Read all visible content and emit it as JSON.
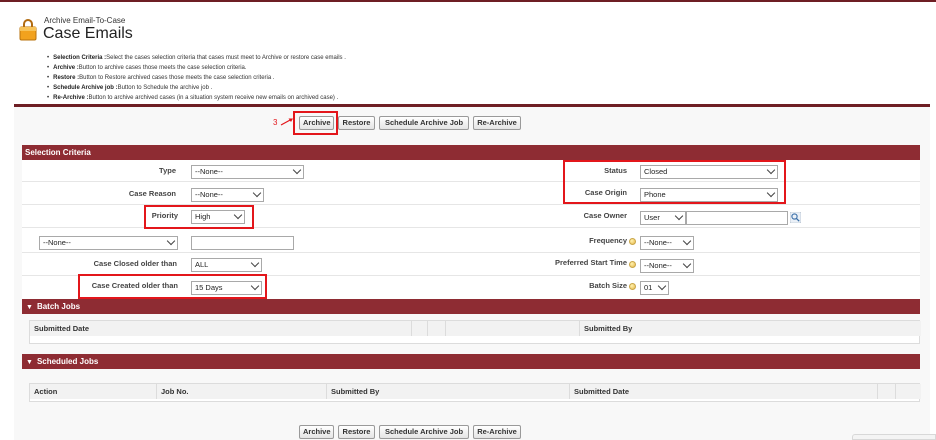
{
  "header": {
    "breadcrumb": "Archive Email-To-Case",
    "title": "Case Emails"
  },
  "description": [
    {
      "term": "Selection Criteria :",
      "text": "Select the cases selection criteria that cases must meet to Archive or restore case emails ."
    },
    {
      "term": "Archive :",
      "text": "Button to archive cases those meets the case selection criteria."
    },
    {
      "term": "Restore :",
      "text": "Button to Restore archived cases those meets the case selection criteria ."
    },
    {
      "term": "Schedule Archive job :",
      "text": "Button to Schedule the archive job ."
    },
    {
      "term": "Re-Archive :",
      "text": "Button to archive archived cases (in a situation system receive new emails on archived case) ."
    }
  ],
  "buttons": {
    "archive": "Archive",
    "restore": "Restore",
    "schedule": "Schedule Archive Job",
    "rearchive": "Re-Archive"
  },
  "annotation_marker": "3",
  "colors": {
    "accent": "#8e2c33",
    "highlight": "#e3161b",
    "topline": "#6e1e24"
  },
  "selection_criteria": {
    "heading": "Selection Criteria",
    "type": {
      "label": "Type",
      "value": "--None--"
    },
    "case_reason": {
      "label": "Case Reason",
      "value": "--None--"
    },
    "priority": {
      "label": "Priority",
      "value": "High"
    },
    "custom_field": {
      "value": "--None--",
      "text_value": ""
    },
    "case_closed_older": {
      "label": "Case Closed older than",
      "value": "ALL"
    },
    "case_created_older": {
      "label": "Case Created older than",
      "value": "15 Days"
    },
    "status": {
      "label": "Status",
      "value": "Closed"
    },
    "case_origin": {
      "label": "Case Origin",
      "value": "Phone"
    },
    "case_owner": {
      "label": "Case Owner",
      "type_value": "User",
      "text_value": ""
    },
    "frequency": {
      "label": "Frequency",
      "value": "--None--"
    },
    "preferred_start_time": {
      "label": "Preferred Start Time",
      "value": "--None--"
    },
    "batch_size": {
      "label": "Batch Size",
      "value": "01"
    }
  },
  "batch_jobs": {
    "heading": "Batch Jobs",
    "columns": [
      "Submitted Date",
      "Submitted By"
    ]
  },
  "scheduled_jobs": {
    "heading": "Scheduled Jobs",
    "columns": [
      "Action",
      "Job No.",
      "Submitted By",
      "Submitted Date"
    ]
  }
}
